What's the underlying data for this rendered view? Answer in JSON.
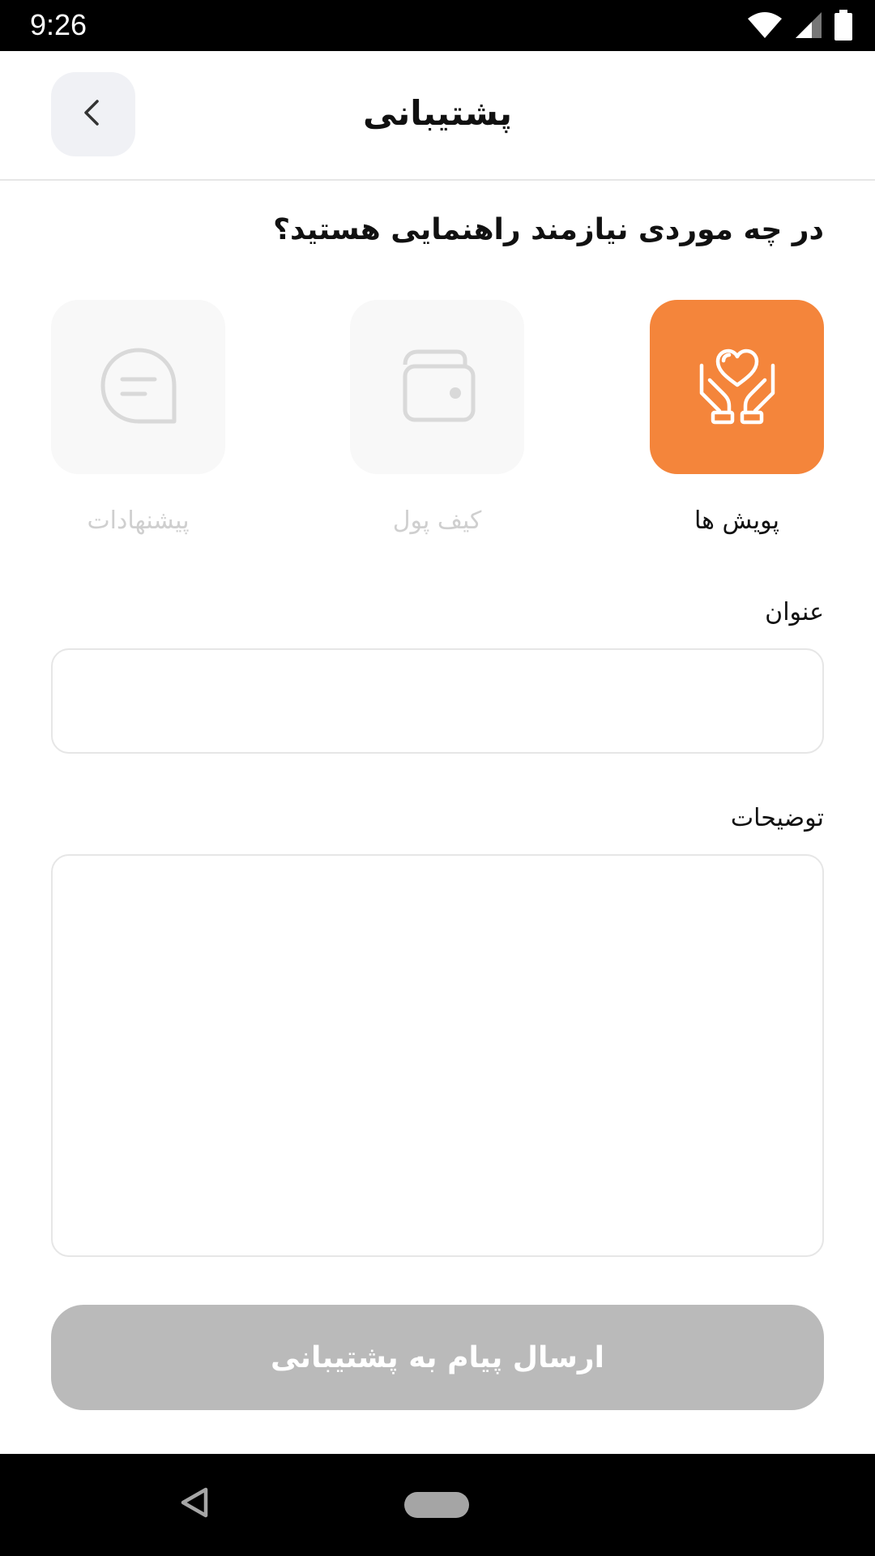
{
  "status_bar": {
    "time": "9:26",
    "icons": [
      "wifi-icon",
      "cellular-signal-icon",
      "battery-icon"
    ]
  },
  "header": {
    "title": "پشتیبانی",
    "back_icon": "chevron-left-icon"
  },
  "question": "در چه موردی نیازمند راهنمایی هستید؟",
  "categories": [
    {
      "label": "پویش ها",
      "icon": "heart-hands-icon",
      "selected": true
    },
    {
      "label": "کیف پول",
      "icon": "wallet-icon",
      "selected": false
    },
    {
      "label": "پیشنهادات",
      "icon": "chat-bubble-icon",
      "selected": false
    }
  ],
  "form": {
    "title_label": "عنوان",
    "title_value": "",
    "description_label": "توضیحات",
    "description_value": ""
  },
  "submit_label": "ارسال پیام به پشتیبانی",
  "colors": {
    "accent": "#f4853b",
    "disabled_button": "#bababa",
    "inactive_tile": "#f8f8f8",
    "back_button_bg": "#f0f1f5"
  }
}
